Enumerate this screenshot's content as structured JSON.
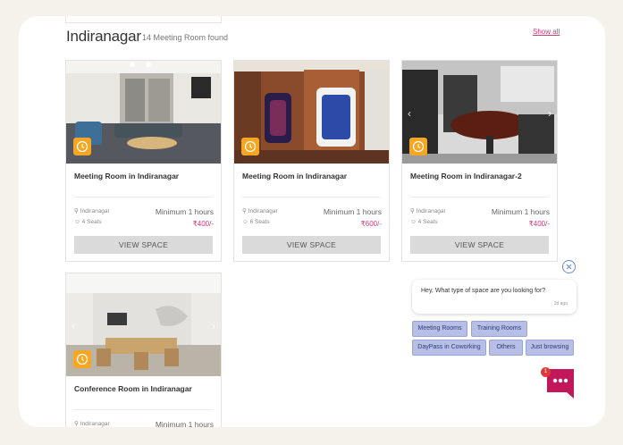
{
  "section": {
    "title": "Indiranagar",
    "count_text": "14 Meeting Room found",
    "show_all_label": "Show all"
  },
  "cards": [
    {
      "name": "Meeting Room in Indiranagar",
      "location": "Indiranagar",
      "seats": "4 Seats",
      "minimum": "Minimum 1 hours",
      "price": "₹400/-",
      "button": "VIEW SPACE"
    },
    {
      "name": "Meeting Room in Indiranagar",
      "location": "Indiranagar",
      "seats": "6 Seats",
      "minimum": "Minimum 1 hours",
      "price": "₹600/-",
      "button": "VIEW SPACE"
    },
    {
      "name": "Meeting Room in Indiranagar-2",
      "location": "Indiranagar",
      "seats": "4 Seats",
      "minimum": "Minimum 1 hours",
      "price": "₹400/-",
      "button": "VIEW SPACE"
    },
    {
      "name": "Conference Room in Indiranagar",
      "location": "Indiranagar",
      "minimum": "Minimum 1 hours"
    }
  ],
  "chat": {
    "message": "Hey, What type of space are you looking for?",
    "time": "2d ago",
    "options": [
      "Meeting Rooms",
      "Training Rooms",
      "DayPass in Coworking",
      "Others",
      "Just browsing"
    ],
    "notification_count": "1"
  },
  "colors": {
    "accent": "#d23a7c",
    "badge": "#f5a623",
    "chip": "#b8bfe6",
    "launcher": "#c2185b"
  }
}
